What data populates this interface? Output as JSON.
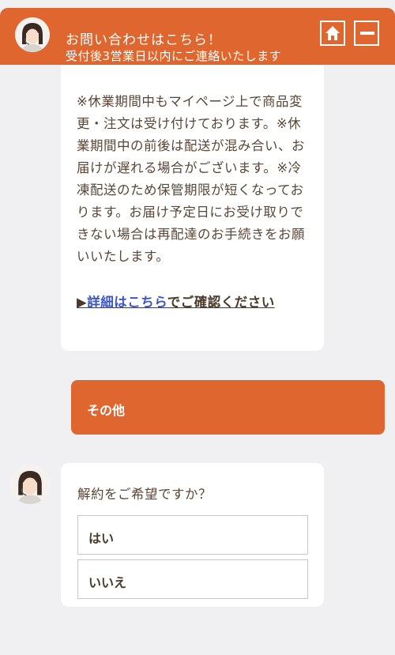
{
  "header": {
    "title": "お問い合わせはこちら！",
    "subtitle": "受付後3営業日以内にご連絡いたします",
    "home_icon": "home-icon",
    "minimize_icon": "minimize-icon"
  },
  "notice": {
    "paragraph": "※休業期間中もマイページ上で商品変更・注文は受け付けております。※休業期間中の前後は配送が混み合い、お届けが遅れる場合がございます。※冷凍配送のため保管期限が短くなっております。お届け予定日にお受け取りできない場合は再配達のお手続きをお願いいたします。",
    "link_prefix": "▶",
    "link_text": "詳細はこちら",
    "link_suffix": "でご確認ください"
  },
  "user_message": {
    "text": "その他"
  },
  "question": {
    "text": "解約をご希望ですか？",
    "options": [
      "はい",
      "いいえ"
    ]
  },
  "colors": {
    "accent": "#e0662f",
    "background": "#f0f0f3",
    "text": "#5a4636",
    "link": "#3b56c8"
  }
}
